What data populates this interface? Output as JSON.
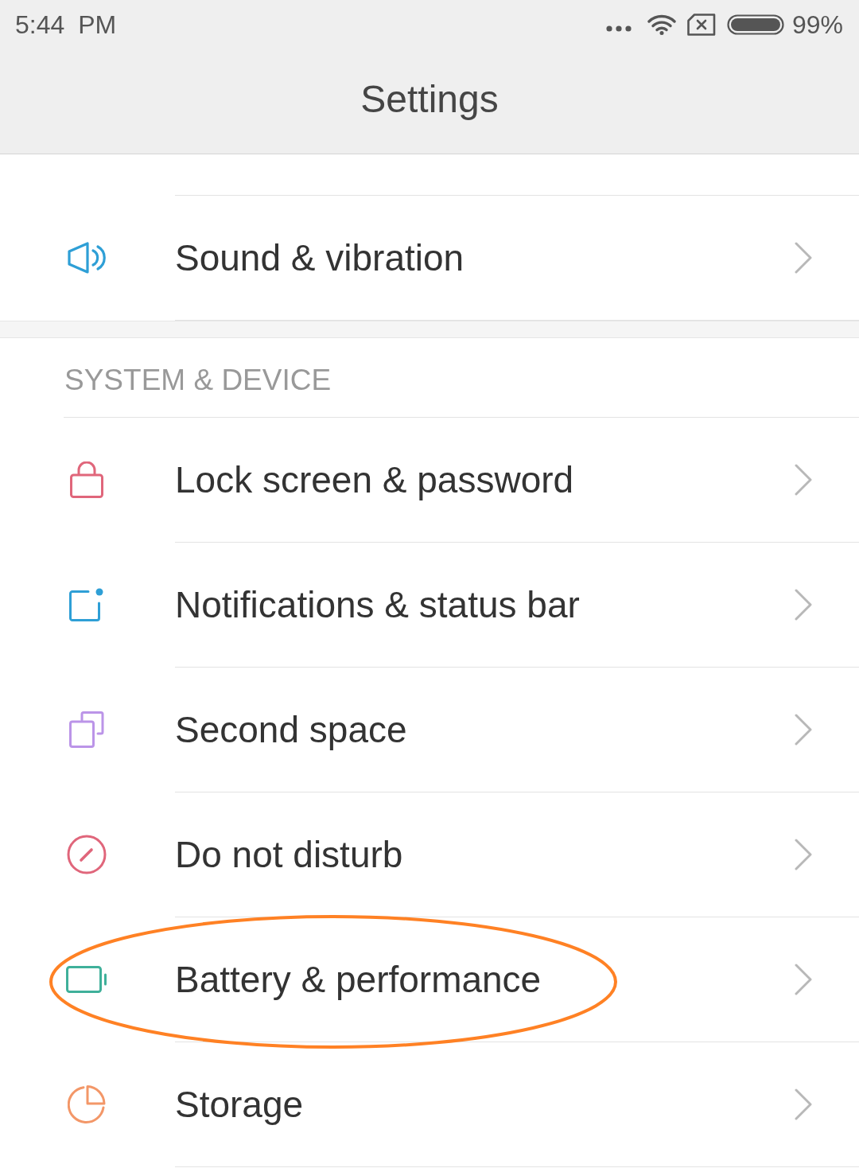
{
  "status_bar": {
    "time": "5:44 PM",
    "battery": "99%"
  },
  "title": "Settings",
  "sections": [
    {
      "items": [
        {
          "kind": "sound",
          "label": "Sound & vibration",
          "circled": false
        }
      ]
    },
    {
      "header": "SYSTEM & DEVICE",
      "items": [
        {
          "kind": "lock",
          "label": "Lock screen & password",
          "circled": false
        },
        {
          "kind": "notifications",
          "label": "Notifications & status bar",
          "circled": false
        },
        {
          "kind": "space",
          "label": "Second space",
          "circled": false
        },
        {
          "kind": "dnd",
          "label": "Do not disturb",
          "circled": false
        },
        {
          "kind": "battery",
          "label": "Battery & performance",
          "circled": true
        },
        {
          "kind": "storage",
          "label": "Storage",
          "circled": false
        }
      ]
    }
  ]
}
